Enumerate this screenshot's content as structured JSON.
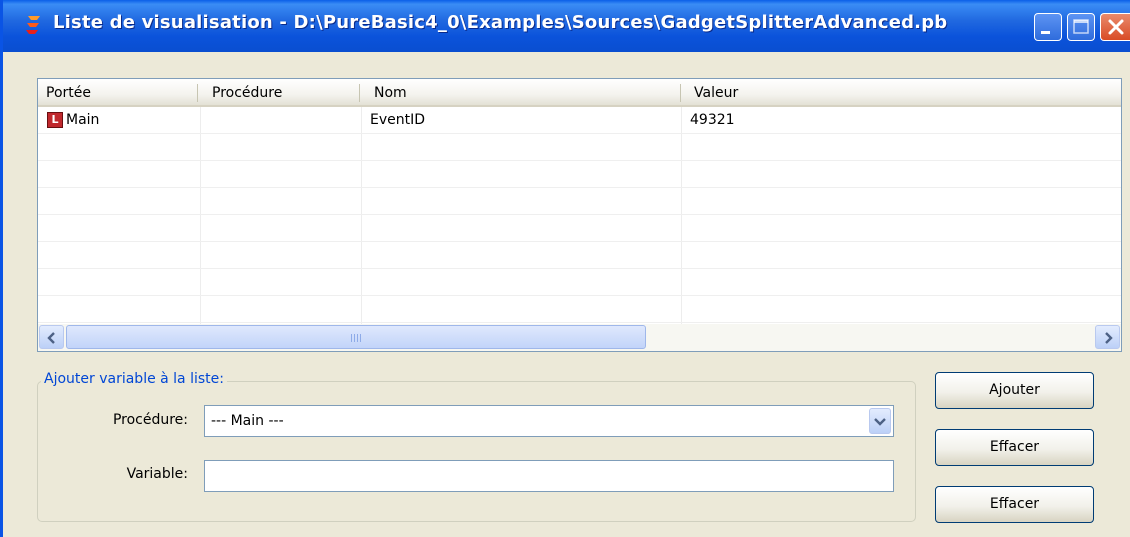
{
  "window": {
    "title": "Liste de visualisation - D:\\PureBasic4_0\\Examples\\Sources\\GadgetSplitterAdvanced.pb",
    "titlebar_color": "#0b53db",
    "controls": [
      "minimize-icon",
      "maximize-icon",
      "close-icon"
    ]
  },
  "list": {
    "columns": [
      "Portée",
      "Procédure",
      "Nom",
      "Valeur"
    ],
    "rows": [
      {
        "scope_icon": "L",
        "scope": "Main",
        "procedure": "",
        "name": "EventID",
        "value": "49321"
      }
    ],
    "scroll_grip": "III",
    "empty_row_count": 7
  },
  "add_group": {
    "legend": "Ajouter variable à la liste:",
    "procedure_label": "Procédure:",
    "procedure_value": "--- Main ---",
    "variable_label": "Variable:",
    "variable_value": ""
  },
  "buttons": {
    "add": "Ajouter",
    "remove": "Effacer",
    "clear": "Effacer"
  },
  "colors": {
    "accent": "#0046d5",
    "scope_icon_bg": "#c0282d",
    "window_bg": "#ece9d8"
  }
}
